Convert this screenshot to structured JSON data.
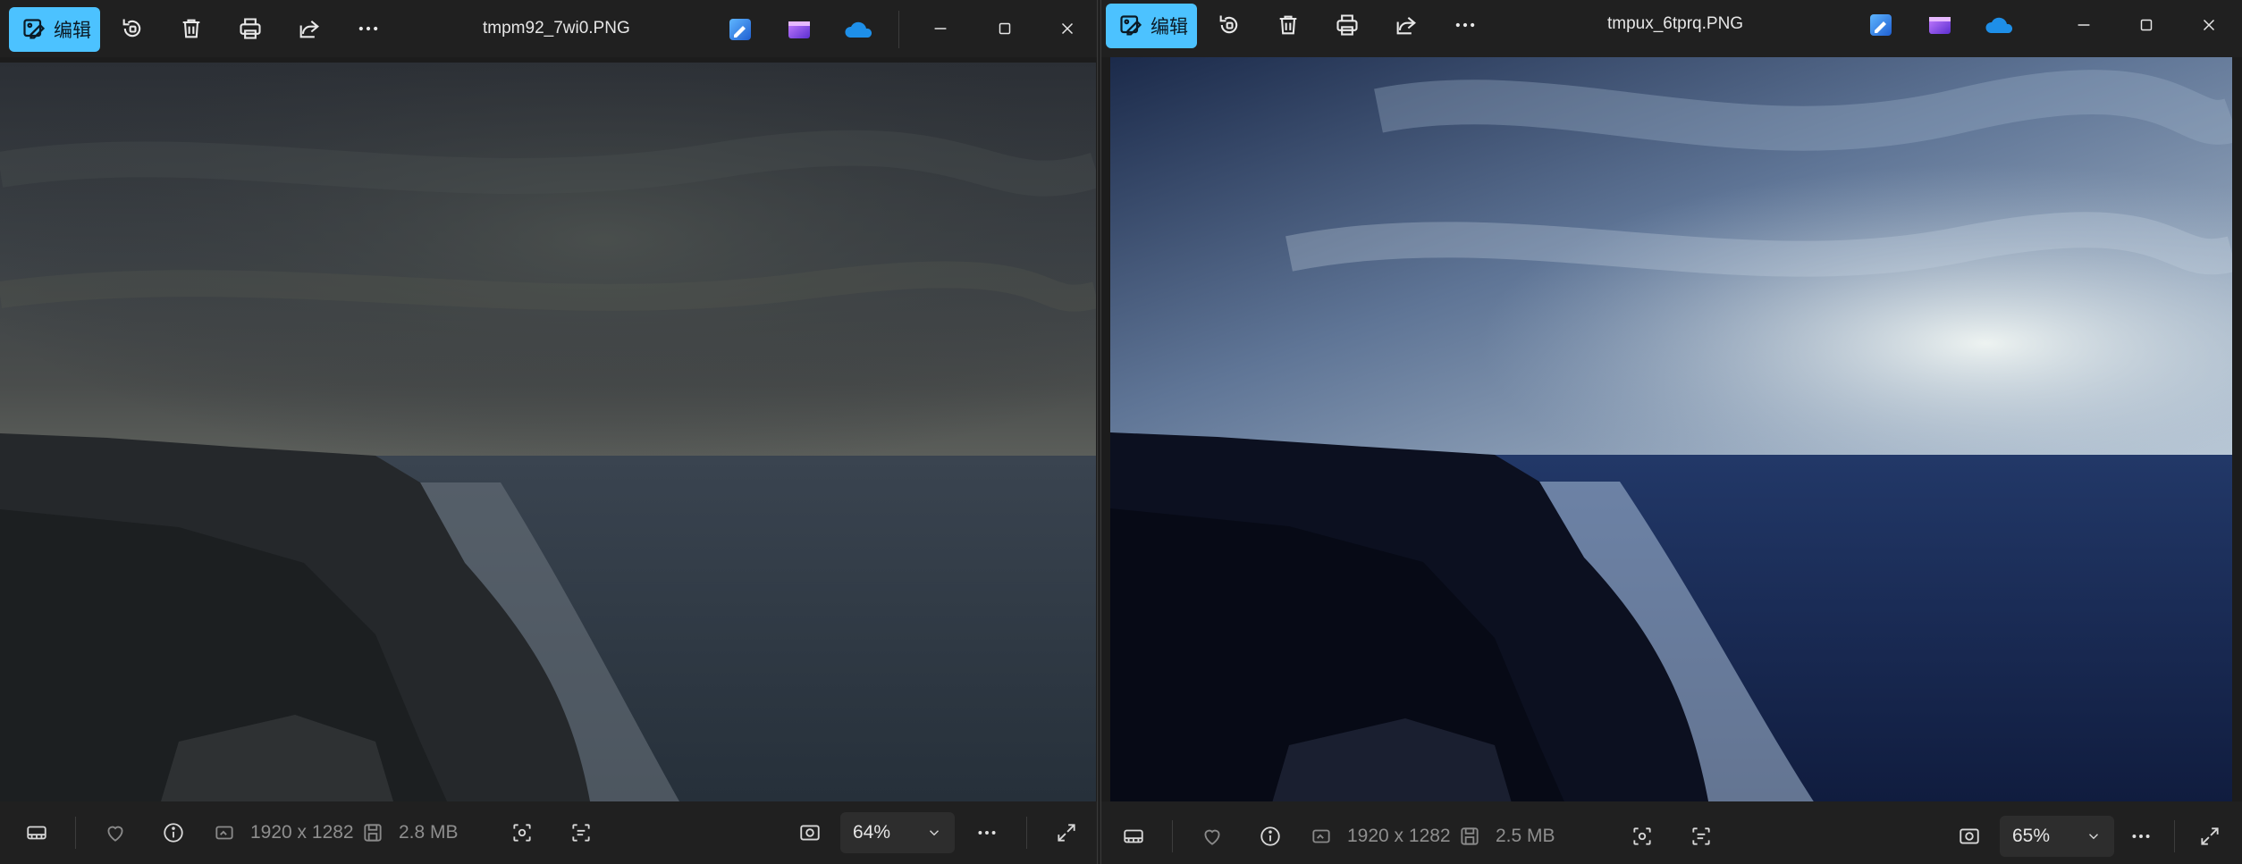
{
  "left_window": {
    "title": "tmpm92_7wi0.PNG",
    "edit_label": "编辑",
    "dimensions": "1920 x 1282",
    "file_size": "2.8 MB",
    "zoom": "64%"
  },
  "right_window": {
    "title": "tmpux_6tprq.PNG",
    "edit_label": "编辑",
    "dimensions": "1920 x 1282",
    "file_size": "2.5 MB",
    "zoom": "65%"
  },
  "colors": {
    "accent": "#4cc2ff",
    "background": "#202020",
    "left_photo_tone": "#3b4249",
    "right_photo_tone": "#22305a"
  },
  "icons": {
    "toolbar": [
      "edit-icon",
      "rotate-icon",
      "delete-icon",
      "print-icon",
      "share-icon",
      "more-icon"
    ],
    "apps": [
      "photo-editor-app-icon",
      "clipchamp-app-icon",
      "onedrive-icon"
    ],
    "window_controls": [
      "minimize-icon",
      "maximize-icon",
      "close-icon"
    ],
    "status": [
      "filmstrip-icon",
      "favorite-icon",
      "info-icon",
      "dimensions-icon",
      "filesize-icon",
      "visual-search-icon",
      "text-scan-icon",
      "fit-to-window-icon",
      "more-icon",
      "fullscreen-icon"
    ]
  }
}
